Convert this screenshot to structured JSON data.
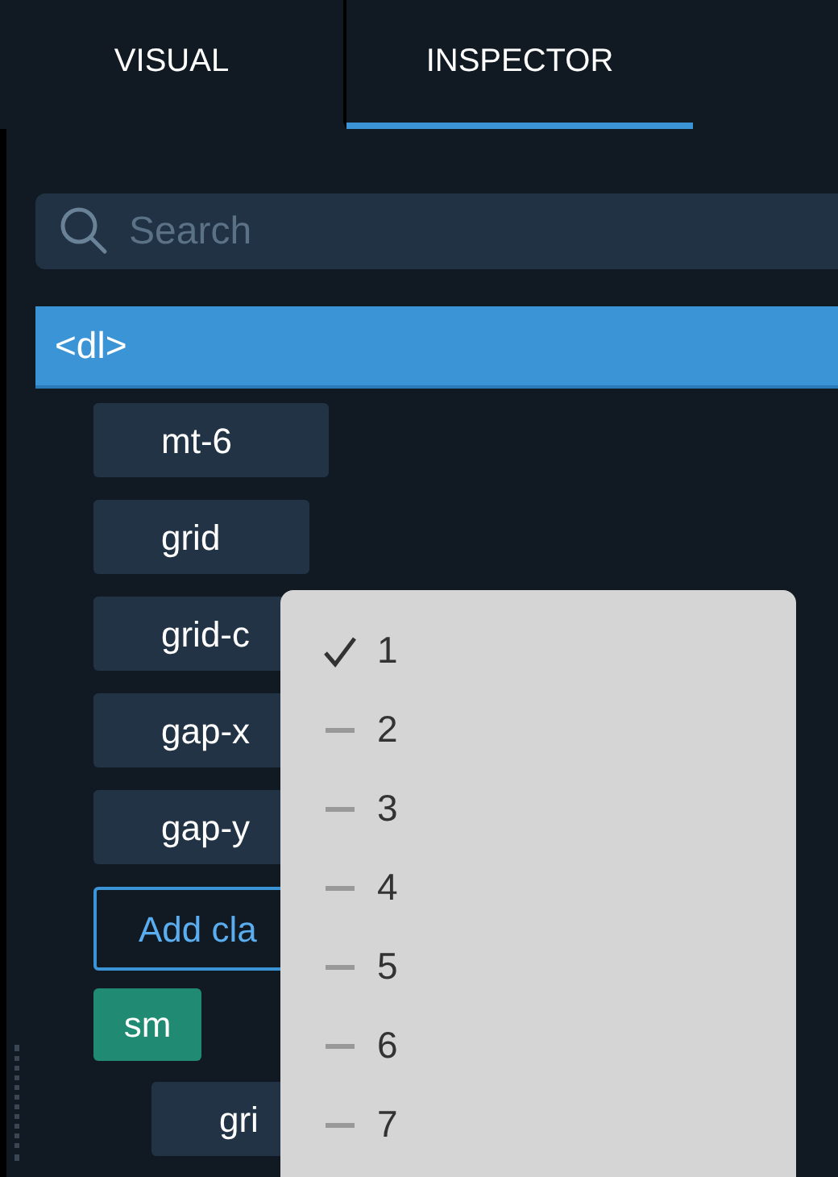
{
  "tabs": [
    {
      "label": "VISUAL",
      "selected": false
    },
    {
      "label": "INSPECTOR",
      "selected": true
    }
  ],
  "search": {
    "placeholder": "Search"
  },
  "element": {
    "label": "<dl>",
    "selected": true
  },
  "classes": [
    {
      "label": "mt-6",
      "kind": "chip"
    },
    {
      "label": "grid",
      "kind": "chip"
    },
    {
      "label": "grid-c",
      "kind": "chip"
    },
    {
      "label": "gap-x",
      "kind": "chip"
    },
    {
      "label": "gap-y",
      "kind": "chip"
    },
    {
      "label": "Add cla",
      "kind": "add"
    }
  ],
  "breakpoint": {
    "label": "sm",
    "children": [
      {
        "label": "gri",
        "kind": "chip"
      }
    ]
  },
  "menu": {
    "items": [
      {
        "label": "1",
        "selected": true
      },
      {
        "label": "2",
        "selected": false
      },
      {
        "label": "3",
        "selected": false
      },
      {
        "label": "4",
        "selected": false
      },
      {
        "label": "5",
        "selected": false
      },
      {
        "label": "6",
        "selected": false
      },
      {
        "label": "7",
        "selected": false
      }
    ]
  }
}
